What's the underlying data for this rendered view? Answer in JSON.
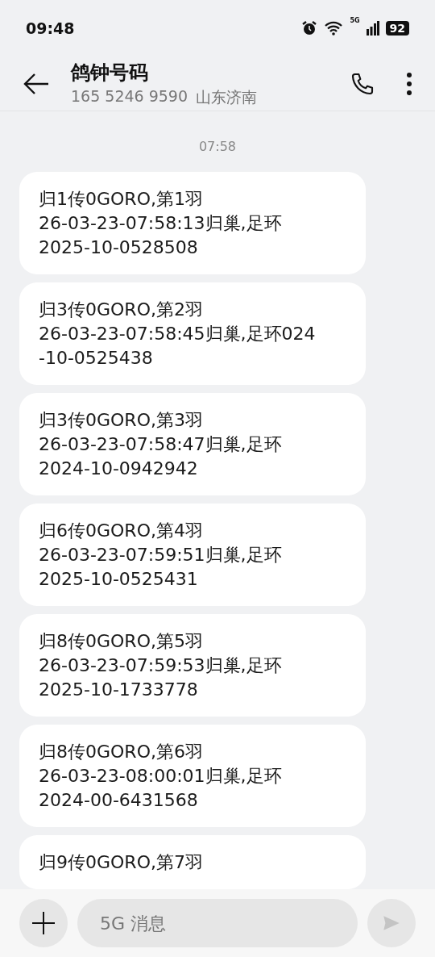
{
  "status_bar": {
    "time": "09:48",
    "network": "5G",
    "battery": "92"
  },
  "header": {
    "title": "鸽钟号码",
    "number": "165 5246 9590",
    "location": "山东济南"
  },
  "time_divider": "07:58",
  "messages": [
    {
      "lines": [
        "归1传0GORO,第1羽",
        "26-03-23-07:58:13归巢,足环",
        "2025-10-0528508"
      ]
    },
    {
      "lines": [
        "归3传0GORO,第2羽",
        "26-03-23-07:58:45归巢,足环024",
        "-10-0525438"
      ]
    },
    {
      "lines": [
        "归3传0GORO,第3羽",
        "26-03-23-07:58:47归巢,足环",
        "2024-10-0942942"
      ]
    },
    {
      "lines": [
        "归6传0GORO,第4羽",
        "26-03-23-07:59:51归巢,足环",
        "2025-10-0525431"
      ]
    },
    {
      "lines": [
        "归8传0GORO,第5羽",
        "26-03-23-07:59:53归巢,足环",
        "2025-10-1733778"
      ]
    },
    {
      "lines": [
        "归8传0GORO,第6羽",
        "26-03-23-08:00:01归巢,足环",
        "2024-00-6431568"
      ]
    },
    {
      "lines": [
        "归9传0GORO,第7羽"
      ]
    }
  ],
  "composer": {
    "placeholder": "5G 消息"
  }
}
